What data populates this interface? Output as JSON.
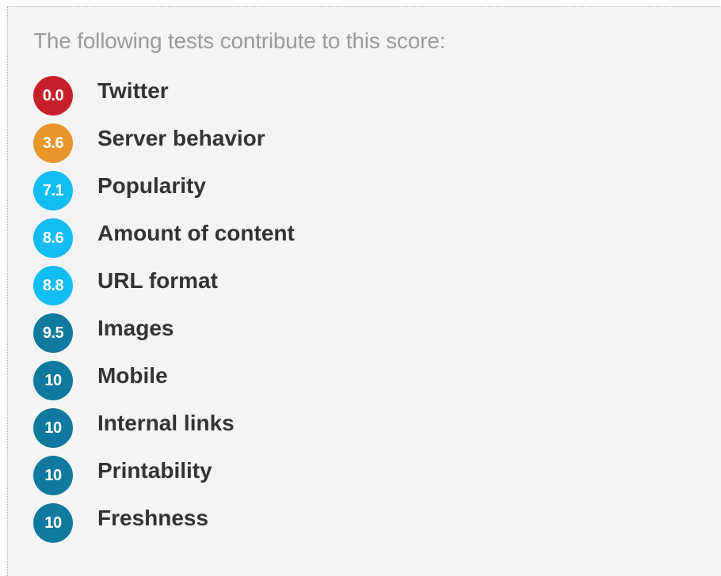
{
  "intro": "The following tests contribute to this score:",
  "colors": {
    "red": "#c8202a",
    "orange": "#e7962a",
    "light_blue": "#11bdf2",
    "dark_blue": "#0f7a9d"
  },
  "tests": [
    {
      "score": "0.0",
      "label": "Twitter",
      "color": "#c8202a"
    },
    {
      "score": "3.6",
      "label": "Server behavior",
      "color": "#e7962a"
    },
    {
      "score": "7.1",
      "label": "Popularity",
      "color": "#11bdf2"
    },
    {
      "score": "8.6",
      "label": "Amount of content",
      "color": "#11bdf2"
    },
    {
      "score": "8.8",
      "label": "URL format",
      "color": "#11bdf2"
    },
    {
      "score": "9.5",
      "label": "Images",
      "color": "#0f7a9d"
    },
    {
      "score": "10",
      "label": "Mobile",
      "color": "#0f7a9d"
    },
    {
      "score": "10",
      "label": "Internal links",
      "color": "#0f7a9d"
    },
    {
      "score": "10",
      "label": "Printability",
      "color": "#0f7a9d"
    },
    {
      "score": "10",
      "label": "Freshness",
      "color": "#0f7a9d"
    }
  ]
}
